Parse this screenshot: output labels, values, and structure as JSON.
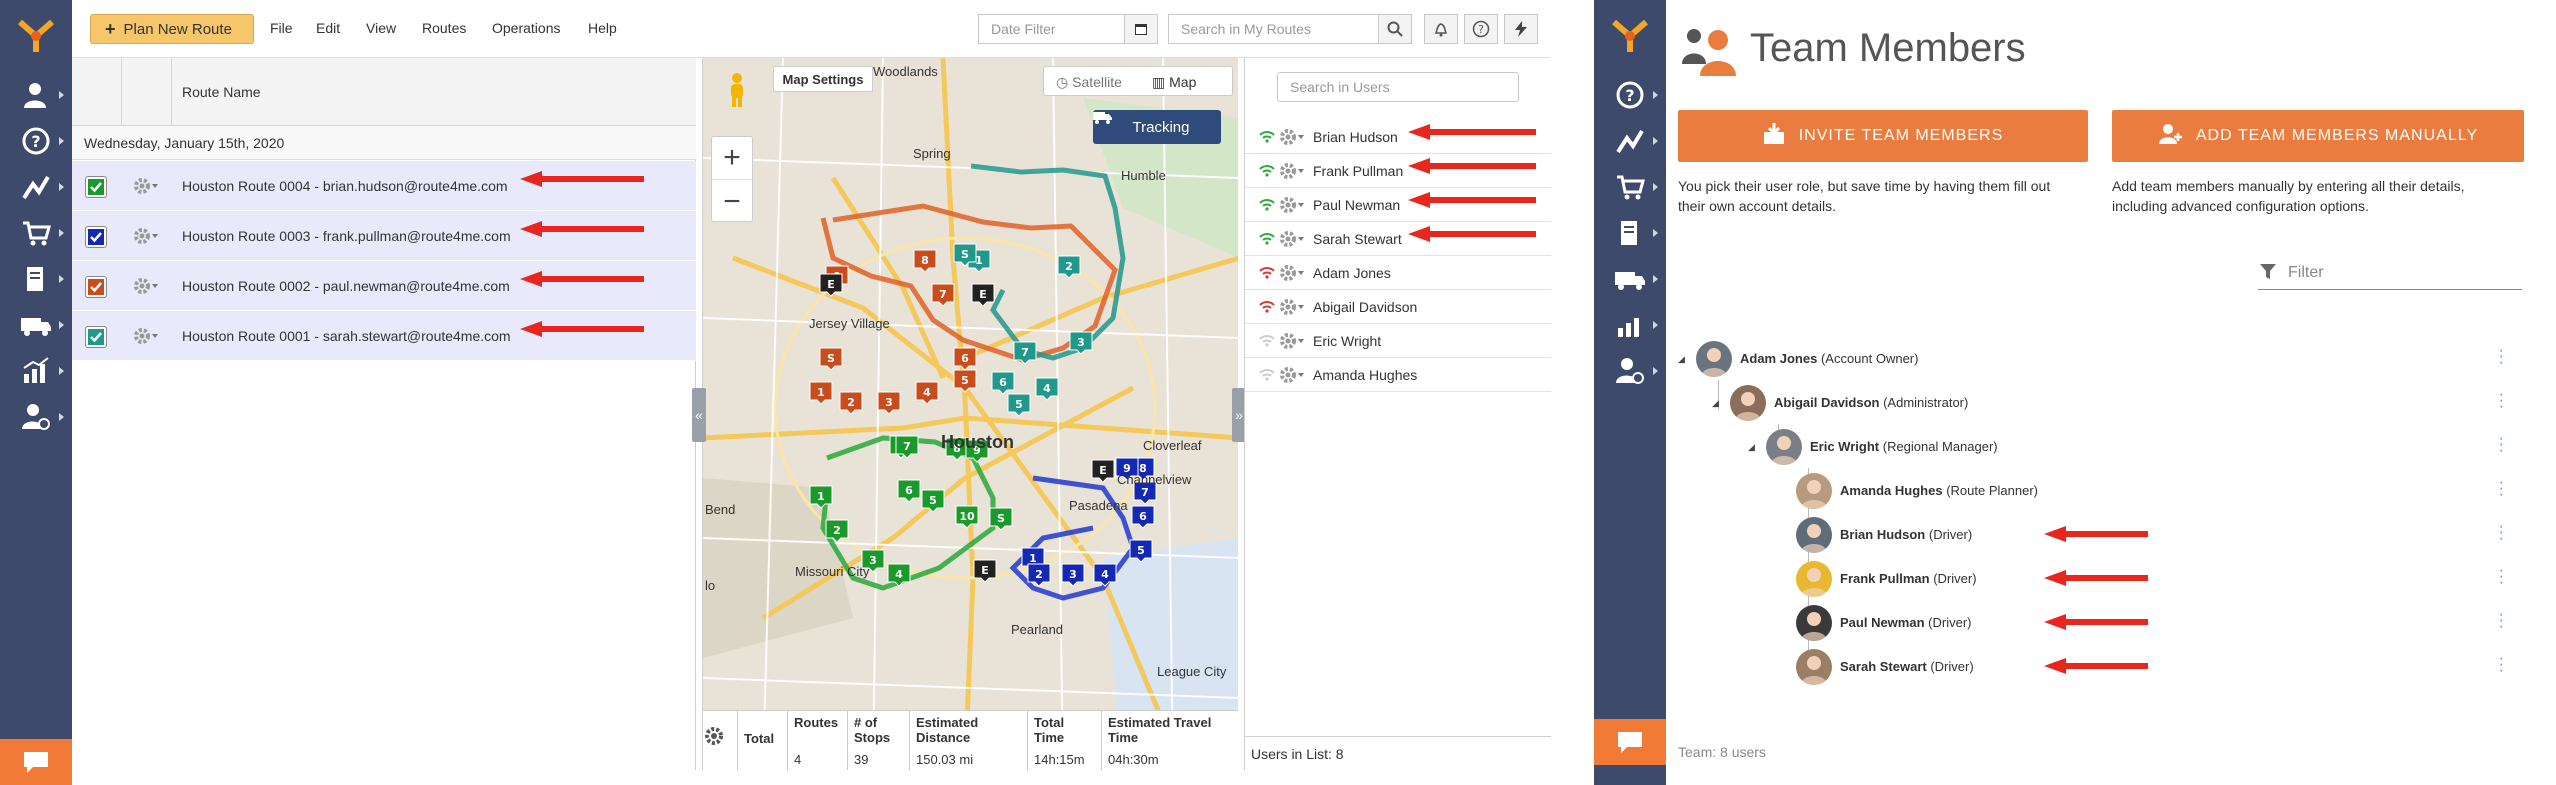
{
  "left_app": {
    "menu": {
      "plan_button": "Plan New Route",
      "items": [
        "File",
        "Edit",
        "View",
        "Routes",
        "Operations",
        "Help"
      ],
      "date_filter_placeholder": "Date Filter",
      "search_placeholder": "Search in My Routes"
    },
    "routes_panel": {
      "column_title": "Route Name",
      "date_label": "Wednesday, January 15th, 2020",
      "rows": [
        {
          "name": "Houston Route 0004 - brian.hudson@route4me.com",
          "color": "#1a9a2b"
        },
        {
          "name": "Houston Route 0003 - frank.pullman@route4me.com",
          "color": "#1428b4"
        },
        {
          "name": "Houston Route 0002 - paul.newman@route4me.com",
          "color": "#c84c1c"
        },
        {
          "name": "Houston Route 0001 - sarah.stewart@route4me.com",
          "color": "#20988c"
        }
      ]
    },
    "map": {
      "map_settings_label": "Map Settings",
      "satellite_label": "Satellite",
      "map_label": "Map",
      "tracking_label": "Tracking",
      "zoom_in": "+",
      "zoom_out": "−",
      "labels": {
        "woodlands": "Woodlands",
        "spring": "Spring",
        "humble": "Humble",
        "jersey_village": "Jersey Village",
        "cloverleaf": "Cloverleaf",
        "houston": "Houston",
        "channelview": "Channelview",
        "pasadena": "Pasadena",
        "missouri_city": "Missouri City",
        "pearland": "Pearland",
        "bend": "Bend",
        "league_city": "League City",
        "lo": "lo"
      },
      "summary": {
        "total_label": "Total",
        "headers": [
          "Routes",
          "# of Stops",
          "Estimated Distance",
          "Total Time",
          "Estimated Travel Time"
        ],
        "values": [
          "4",
          "39",
          "150.03 mi",
          "14h:15m",
          "04h:30m"
        ]
      }
    },
    "users_panel": {
      "search_placeholder": "Search in Users",
      "users": [
        {
          "name": "Brian Hudson",
          "signal": "#2eaa3a"
        },
        {
          "name": "Frank Pullman",
          "signal": "#2eaa3a"
        },
        {
          "name": "Paul Newman",
          "signal": "#2eaa3a"
        },
        {
          "name": "Sarah Stewart",
          "signal": "#2eaa3a"
        },
        {
          "name": "Adam Jones",
          "signal": "#d43a3a"
        },
        {
          "name": "Abigail Davidson",
          "signal": "#d43a3a"
        },
        {
          "name": "Eric Wright",
          "signal": "#cccccc"
        },
        {
          "name": "Amanda Hughes",
          "signal": "#cccccc"
        }
      ],
      "footer": "Users in List: 8"
    }
  },
  "right_app": {
    "title": "Team Members",
    "invite_button": "INVITE TEAM MEMBERS",
    "add_manual_button": "ADD TEAM MEMBERS MANUALLY",
    "invite_desc_1": "You pick their user role, but save time by having them fill out",
    "invite_desc_2": "their own account details.",
    "manual_desc_1": "Add team members manually by entering all their details,",
    "manual_desc_2": "including advanced configuration options.",
    "filter_placeholder": "Filter",
    "tree": [
      {
        "name": "Adam Jones",
        "role": "(Account Owner)"
      },
      {
        "name": "Abigail Davidson",
        "role": "(Administrator)"
      },
      {
        "name": "Eric Wright",
        "role": "(Regional Manager)"
      },
      {
        "name": "Amanda Hughes",
        "role": "(Route Planner)"
      },
      {
        "name": "Brian Hudson",
        "role": "(Driver)"
      },
      {
        "name": "Frank Pullman",
        "role": "(Driver)"
      },
      {
        "name": "Paul Newman",
        "role": "(Driver)"
      },
      {
        "name": "Sarah Stewart",
        "role": "(Driver)"
      }
    ],
    "footer": "Team: 8 users"
  },
  "colors": {
    "sidebar": "#3e4a6b",
    "accent_orange": "#ea7c3f",
    "plan_button": "#f5c66a",
    "tracking": "#2f4b7c",
    "arrow_red": "#e8261e"
  }
}
